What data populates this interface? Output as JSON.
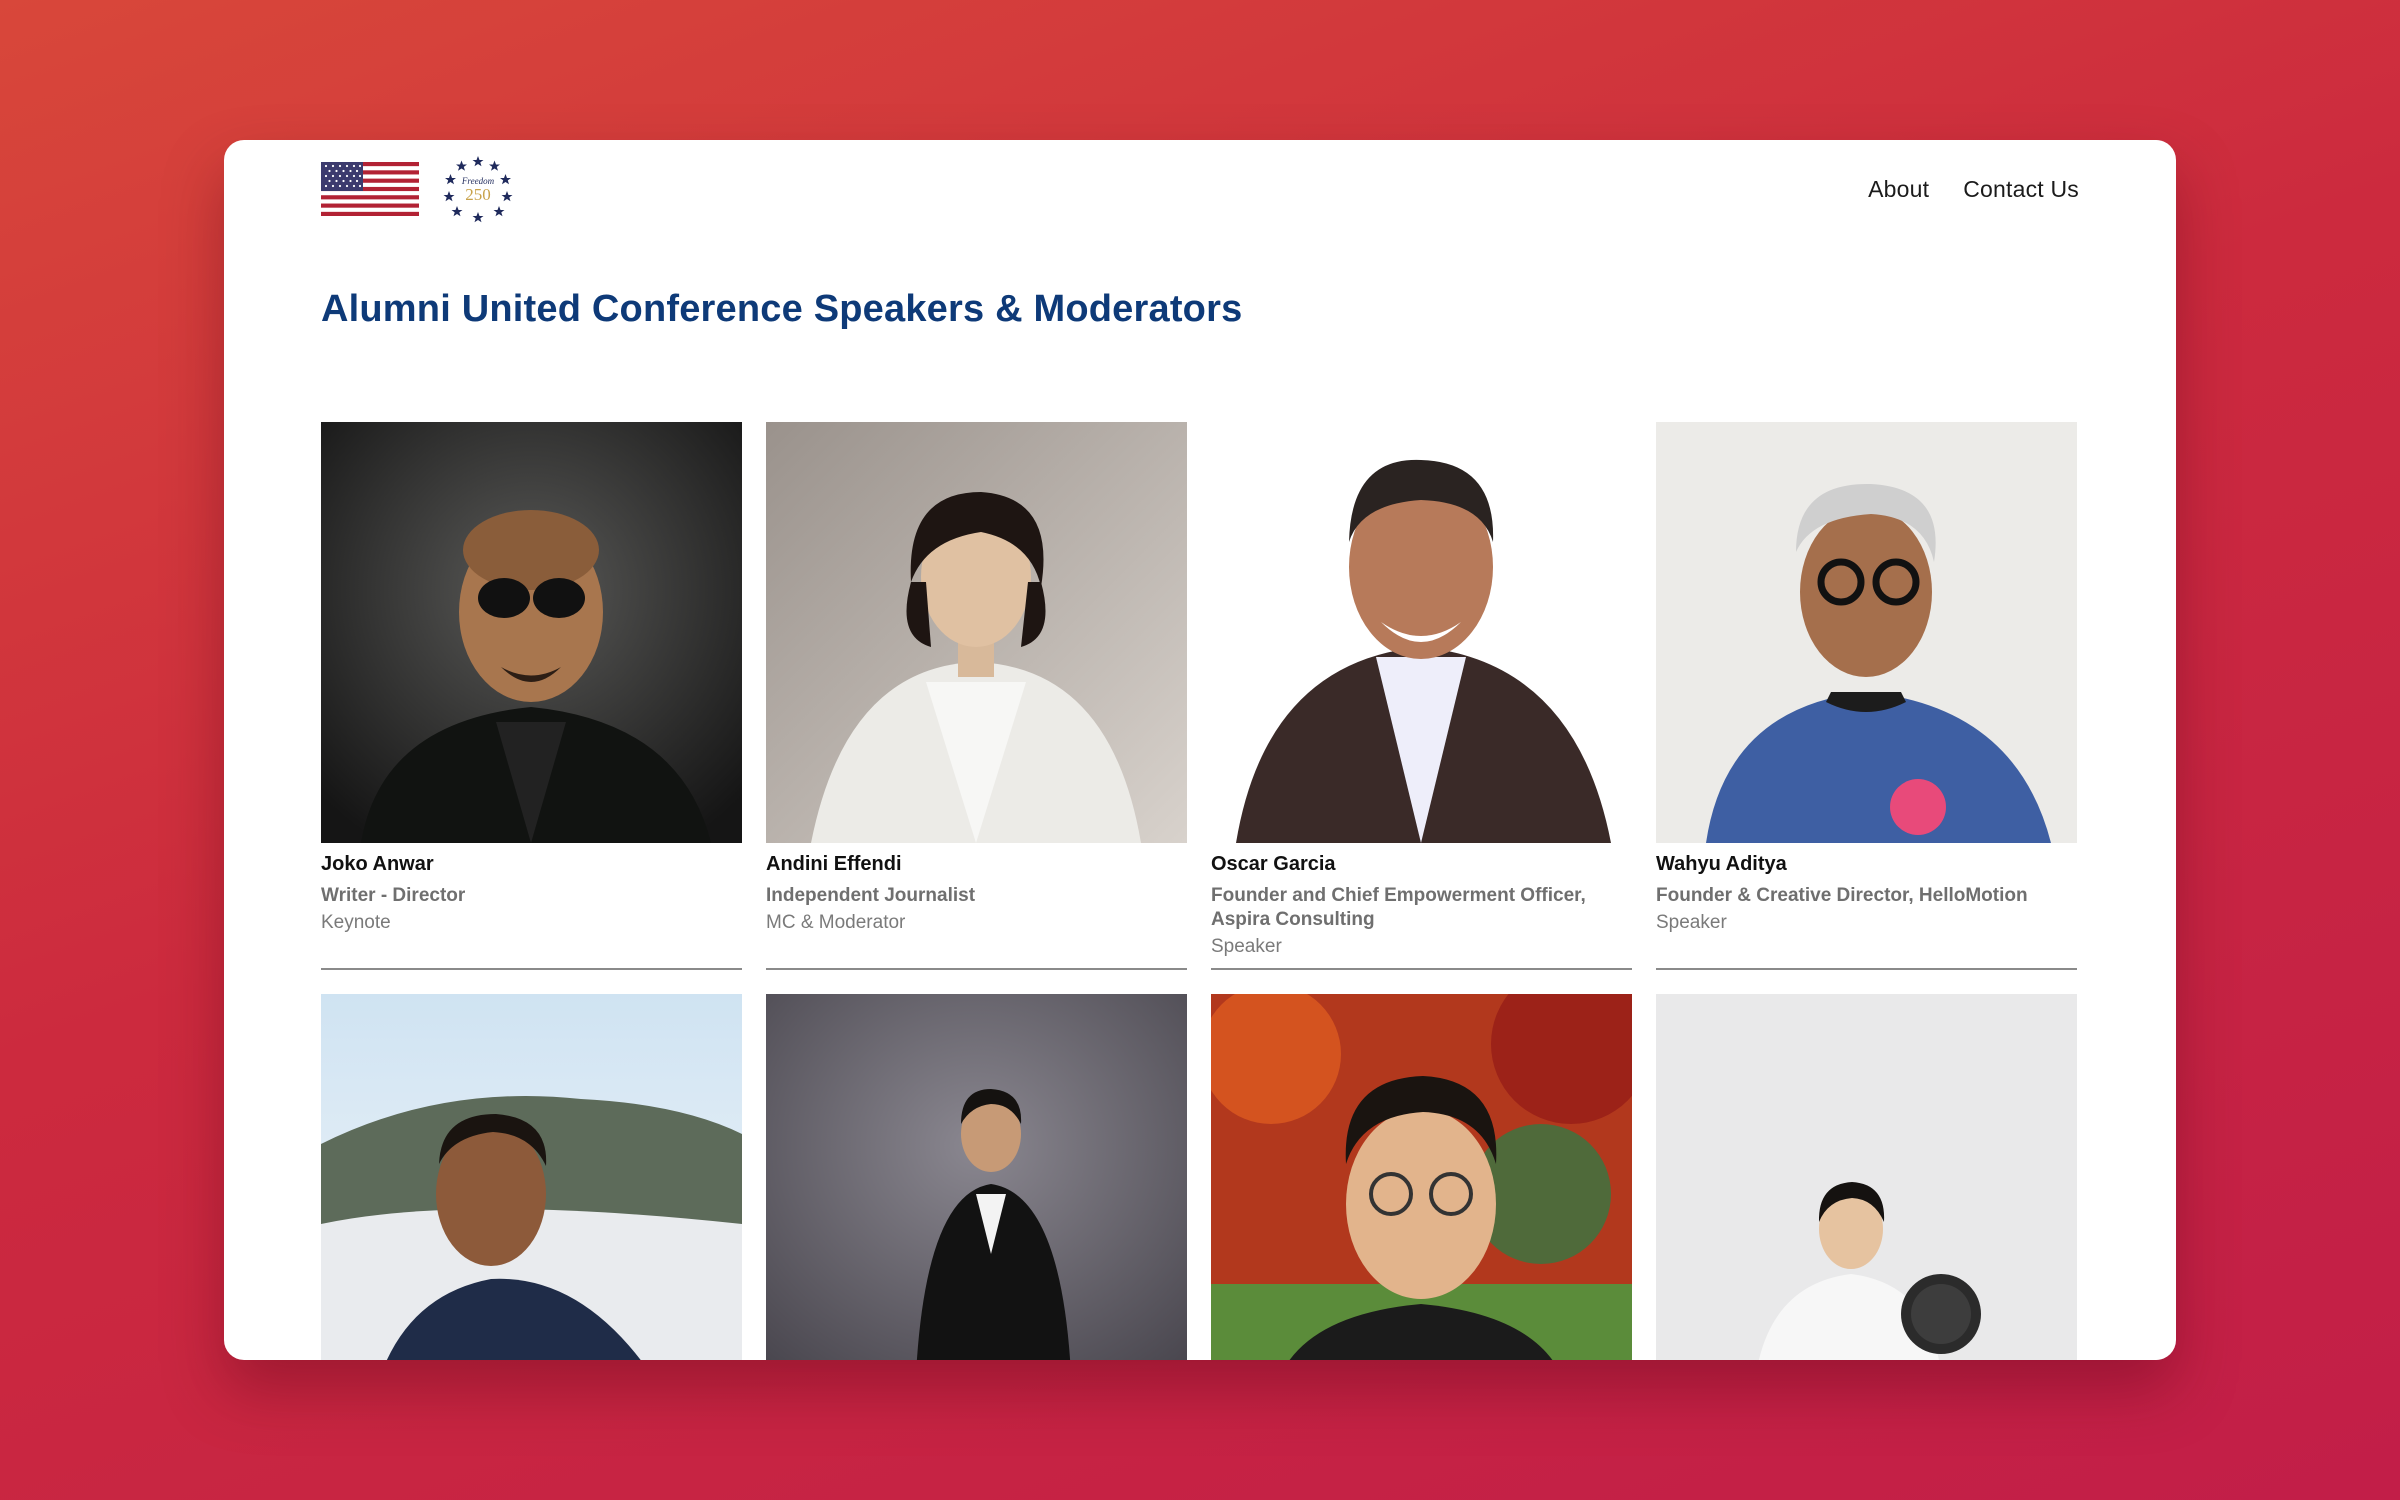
{
  "header": {
    "flag_icon": "us-flag-icon",
    "seal_icon": "freedom-250-seal-icon",
    "seal_text_top": "Freedom",
    "seal_text_num": "250",
    "nav": [
      {
        "label": "About"
      },
      {
        "label": "Contact Us"
      }
    ]
  },
  "page": {
    "title": "Alumni United Conference Speakers & Moderators"
  },
  "speakers": [
    {
      "name": "Joko Anwar",
      "role": "Writer - Director",
      "type": "Keynote"
    },
    {
      "name": "Andini Effendi",
      "role": "Independent Journalist",
      "type": "MC & Moderator"
    },
    {
      "name": "Oscar Garcia",
      "role": "Founder and Chief Empowerment Officer, Aspira Consulting",
      "type": "Speaker"
    },
    {
      "name": "Wahyu Aditya",
      "role": "Founder & Creative Director, HelloMotion",
      "type": "Speaker"
    }
  ],
  "colors": {
    "title": "#0e3a78",
    "background_gradient": [
      "#d8473a",
      "#c21e48"
    ]
  }
}
